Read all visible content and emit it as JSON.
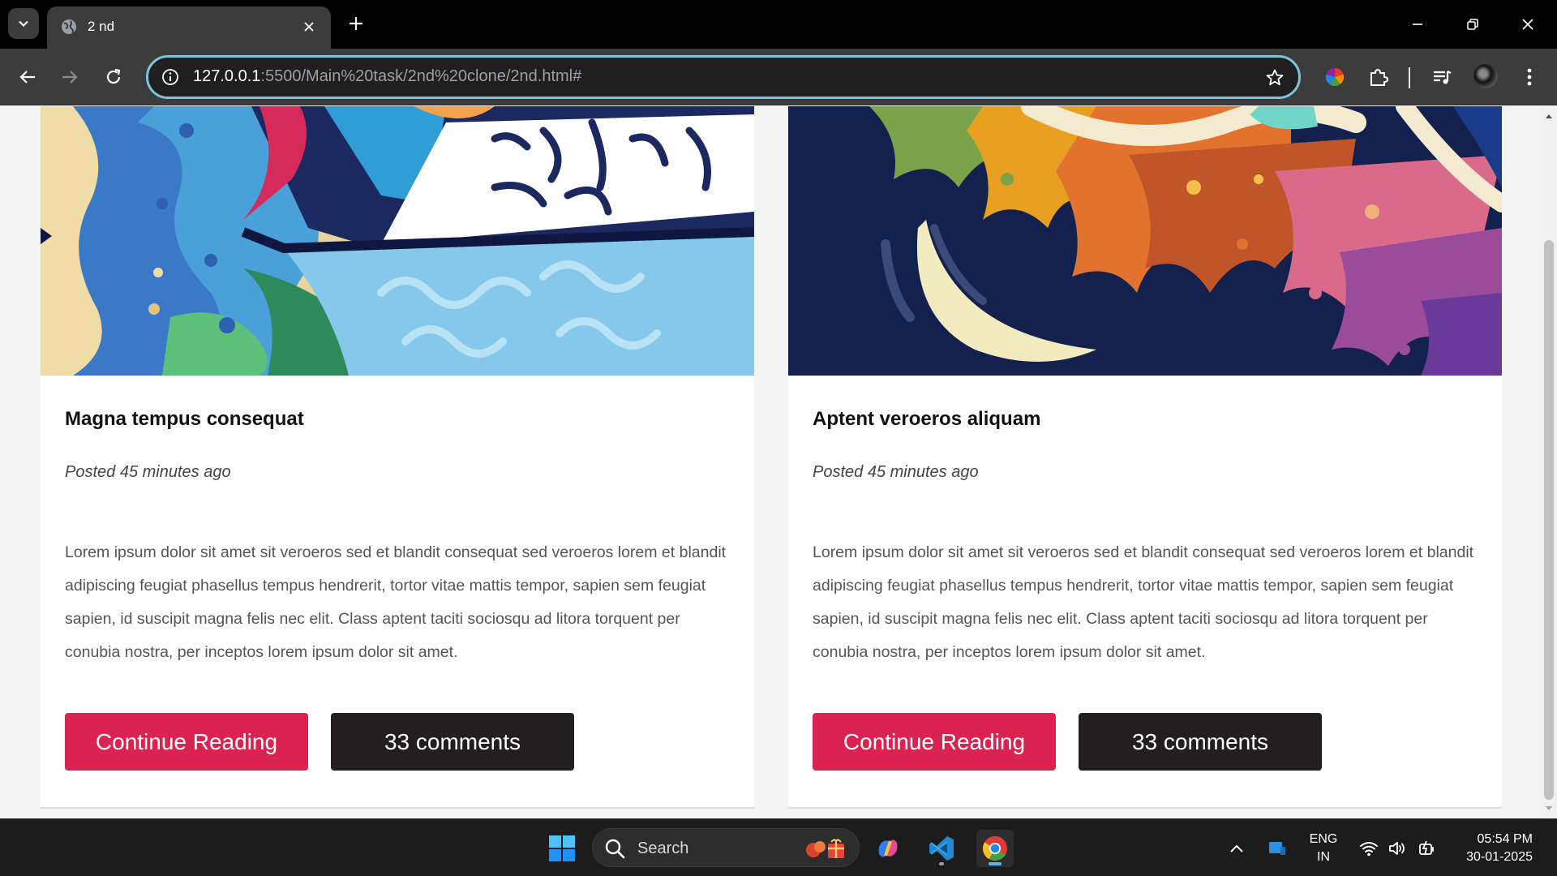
{
  "browser": {
    "tab": {
      "title": "2 nd",
      "favicon": "globe-icon",
      "close_icon": "close-icon"
    },
    "new_tab_icon": "plus-icon",
    "window_controls": [
      "minimize-icon",
      "restore-icon",
      "close-icon"
    ],
    "nav": [
      "back-icon",
      "forward-icon",
      "reload-icon"
    ],
    "address": {
      "host": "127.0.0.1",
      "path": ":5500/Main%20task/2nd%20clone/2nd.html#",
      "info_icon": "site-info-icon",
      "bookmark_icon": "star-icon"
    },
    "extensions": [
      "color-wheel-extension-icon",
      "puzzle-icon",
      "reading-list-icon",
      "profile-avatar",
      "kebab-menu-icon"
    ],
    "accent_color": "#7cc4d9"
  },
  "posts": [
    {
      "title": "Magna tempus consequat",
      "meta": "Posted 45 minutes ago",
      "body": "Lorem ipsum dolor sit amet sit veroeros sed et blandit consequat sed veroeros lorem et blandit adipiscing feugiat phasellus tempus hendrerit, tortor vitae mattis tempor, sapien sem feugiat sapien, id suscipit magna felis nec elit. Class aptent taciti sociosqu ad litora torquent per conubia nostra, per inceptos lorem ipsum dolor sit amet.",
      "read_label": "Continue Reading",
      "comments_label": "33 comments"
    },
    {
      "title": "Aptent veroeros aliquam",
      "meta": "Posted 45 minutes ago",
      "body": "Lorem ipsum dolor sit amet sit veroeros sed et blandit consequat sed veroeros lorem et blandit adipiscing feugiat phasellus tempus hendrerit, tortor vitae mattis tempor, sapien sem feugiat sapien, id suscipit magna felis nec elit. Class aptent taciti sociosqu ad litora torquent per conubia nostra, per inceptos lorem ipsum dolor sit amet.",
      "read_label": "Continue Reading",
      "comments_label": "33 comments"
    }
  ],
  "colors": {
    "primary_button": "#da2350",
    "dark_button": "#231f20"
  },
  "taskbar": {
    "search_label": "Search",
    "apps": [
      "windows-start-icon",
      "copilot-icon",
      "vscode-icon",
      "chrome-icon"
    ],
    "tray": {
      "lang_line1": "ENG",
      "lang_line2": "IN",
      "time": "05:54 PM",
      "date": "30-01-2025",
      "icons": [
        "chevron-up-icon",
        "app-tray-icon",
        "wifi-icon",
        "volume-icon",
        "battery-icon"
      ]
    }
  }
}
